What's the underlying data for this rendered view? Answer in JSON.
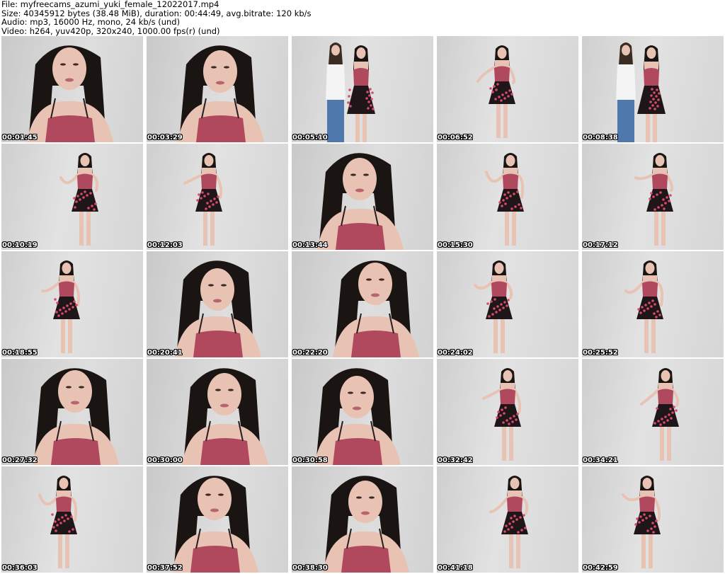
{
  "header": {
    "file_line": "File: myfreecams_azumi_yuki_female_12022017.mp4",
    "size_line": "Size: 40345912 bytes (38.48 MiB), duration: 00:44:49, avg.bitrate: 120 kb/s",
    "audio_line": "Audio: mp3, 16000 Hz, mono, 24 kb/s (und)",
    "video_line": "Video: h264, yuv420p, 320x240, 1000.00 fps(r) (und)"
  },
  "thumbnails": [
    {
      "timestamp": "00:01:45",
      "shot": "closeup"
    },
    {
      "timestamp": "00:03:29",
      "shot": "closeup"
    },
    {
      "timestamp": "00:05:10",
      "shot": "duo"
    },
    {
      "timestamp": "00:06:52",
      "shot": "full"
    },
    {
      "timestamp": "00:08:38",
      "shot": "duo"
    },
    {
      "timestamp": "00:10:19",
      "shot": "full"
    },
    {
      "timestamp": "00:12:03",
      "shot": "full"
    },
    {
      "timestamp": "00:13:44",
      "shot": "closeup"
    },
    {
      "timestamp": "00:15:30",
      "shot": "full"
    },
    {
      "timestamp": "00:17:12",
      "shot": "full"
    },
    {
      "timestamp": "00:18:55",
      "shot": "full"
    },
    {
      "timestamp": "00:20:41",
      "shot": "closeup"
    },
    {
      "timestamp": "00:22:20",
      "shot": "closeup"
    },
    {
      "timestamp": "00:24:02",
      "shot": "full"
    },
    {
      "timestamp": "00:25:52",
      "shot": "full"
    },
    {
      "timestamp": "00:27:32",
      "shot": "closeup"
    },
    {
      "timestamp": "00:30:00",
      "shot": "closeup"
    },
    {
      "timestamp": "00:30:58",
      "shot": "closeup"
    },
    {
      "timestamp": "00:32:42",
      "shot": "full"
    },
    {
      "timestamp": "00:34:21",
      "shot": "full"
    },
    {
      "timestamp": "00:36:03",
      "shot": "full"
    },
    {
      "timestamp": "00:37:52",
      "shot": "closeup"
    },
    {
      "timestamp": "00:38:30",
      "shot": "closeup"
    },
    {
      "timestamp": "00:41:18",
      "shot": "full"
    },
    {
      "timestamp": "00:42:59",
      "shot": "full"
    }
  ],
  "colors": {
    "wall": "#d8d8d8",
    "hair": "#1a1512",
    "skin": "#e8c3b3",
    "top_pattern": "#b0485e",
    "skirt": "#1e1618",
    "skirt_flowers": "#d84a6a",
    "jeans": "#4f78ad",
    "white_top": "#f4f4f4"
  }
}
